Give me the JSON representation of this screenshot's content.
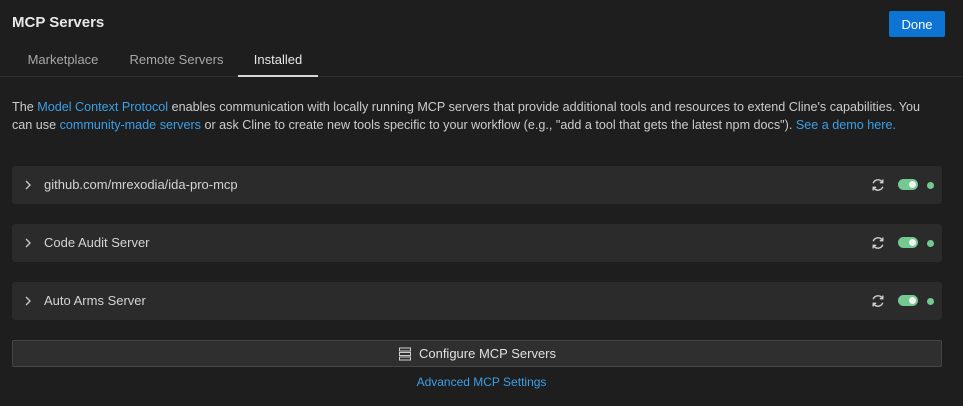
{
  "header": {
    "title": "MCP Servers",
    "done_label": "Done"
  },
  "tabs": [
    {
      "label": "Marketplace",
      "active": false
    },
    {
      "label": "Remote Servers",
      "active": false
    },
    {
      "label": "Installed",
      "active": true
    }
  ],
  "intro": {
    "part1": "The ",
    "link1": "Model Context Protocol",
    "part2": " enables communication with locally running MCP servers that provide additional tools and resources to extend Cline's capabilities. You can use ",
    "link2": "community-made servers",
    "part3": " or ask Cline to create new tools specific to your workflow (e.g., \"add a tool that gets the latest npm docs\"). ",
    "link3": "See a demo here."
  },
  "servers": [
    {
      "name": "github.com/mrexodia/ida-pro-mcp",
      "enabled": true,
      "status": "connected"
    },
    {
      "name": "Code Audit Server",
      "enabled": true,
      "status": "connected"
    },
    {
      "name": "Auto Arms Server",
      "enabled": true,
      "status": "connected"
    }
  ],
  "footer": {
    "configure_label": "Configure MCP Servers",
    "advanced_label": "Advanced MCP Settings"
  },
  "colors": {
    "accent": "#0e74d3",
    "link": "#3c9fe8",
    "status_green": "#74c991"
  },
  "icons": {
    "chevron": "chevron-right-icon",
    "restart": "restart-icon",
    "configure": "server-stack-icon"
  }
}
